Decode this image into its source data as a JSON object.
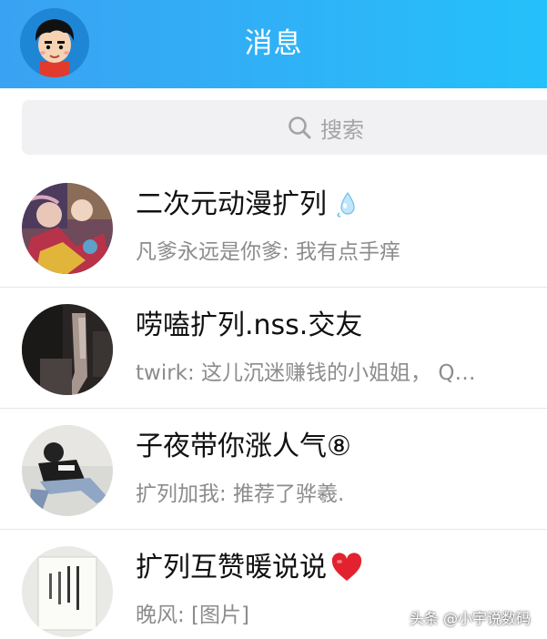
{
  "header": {
    "title": "消息",
    "gradient": [
      "#3aa2f2",
      "#24c1fb"
    ],
    "avatar_icon": "cartoon-boy-avatar"
  },
  "search": {
    "placeholder": "搜索",
    "icon": "search-icon"
  },
  "conversations": [
    {
      "title": "二次元动漫扩列",
      "preview": "凡爹永远是你爹: 我有点手痒",
      "avatar": "anime-group-avatar",
      "title_icon": "water-drop-emoji"
    },
    {
      "title": "唠嗑扩列.nss.交友",
      "preview": "twirk: 这儿沉迷赚钱的小姐姐， Q…",
      "avatar": "dark-photo-avatar"
    },
    {
      "title": "子夜带你涨人气⑧",
      "preview": "扩列加我: 推荐了骅羲.",
      "avatar": "sitting-person-avatar"
    },
    {
      "title": "扩列互赞暖说说",
      "preview": "晚风: [图片]",
      "avatar": "book-page-avatar",
      "title_icon": "red-heart-emoji"
    }
  ],
  "watermark": "头条 @小宇说数码"
}
